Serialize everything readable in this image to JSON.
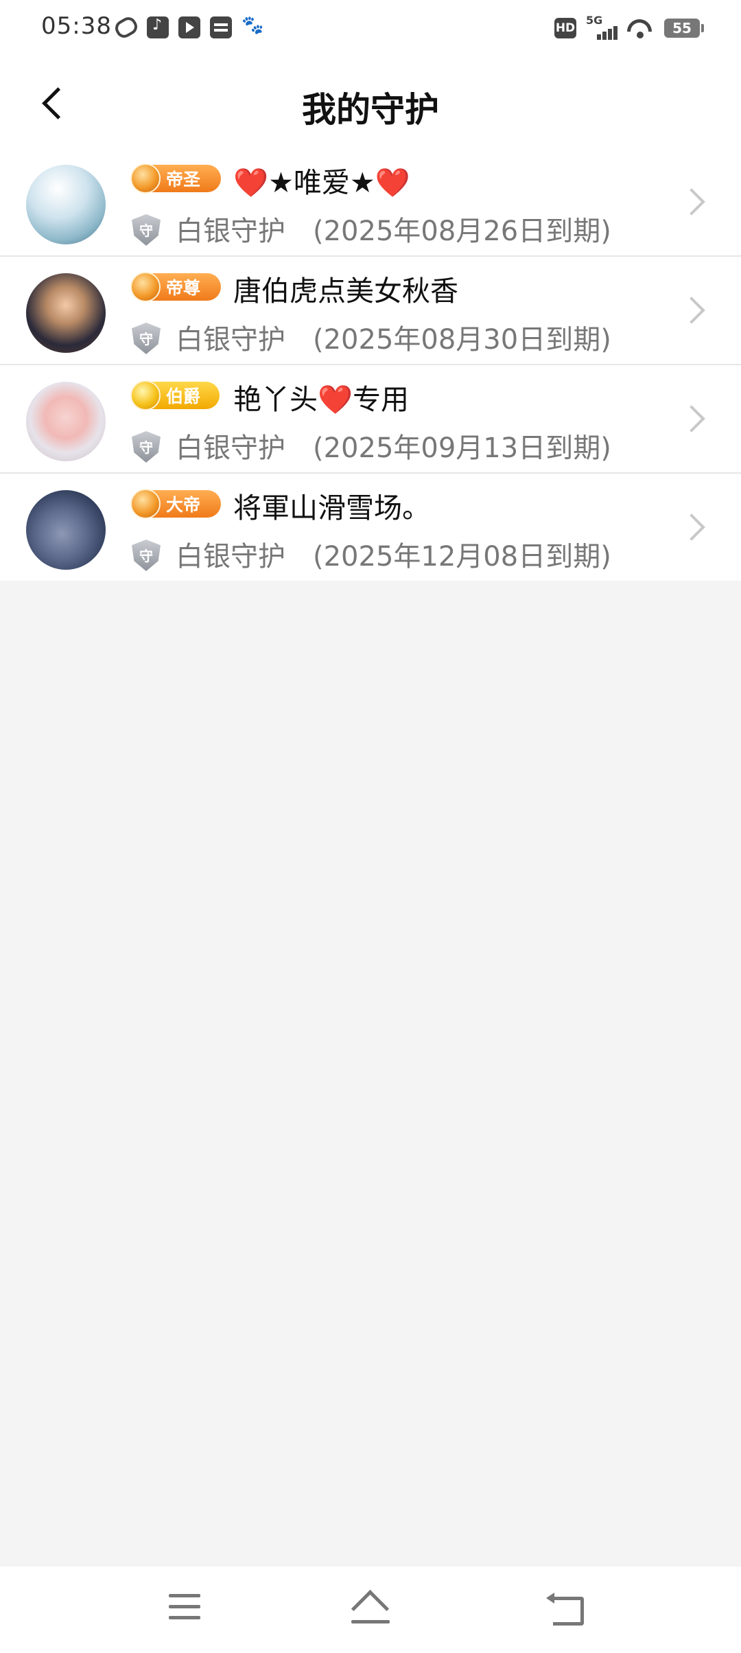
{
  "status_bar": {
    "time": "05:38",
    "notification_icons": [
      "loop-app-icon",
      "tiktok-icon",
      "video-player-icon",
      "wallet-icon",
      "baidu-paw-icon"
    ],
    "hd": "HD",
    "network": "5G",
    "battery": "55"
  },
  "header": {
    "title": "我的守护"
  },
  "guards": [
    {
      "badge": "帝圣",
      "badge_color": "#f07a1a",
      "nickname_parts": [
        "❤️",
        "★唯爱★",
        "❤️"
      ],
      "tier": "白银守护",
      "expiry": "(2025年08月26日到期)"
    },
    {
      "badge": "帝尊",
      "badge_color": "#f07a1a",
      "nickname": "唐伯虎点美女秋香",
      "tier": "白银守护",
      "expiry": "(2025年08月30日到期)"
    },
    {
      "badge": "伯爵",
      "badge_color": "#f2a900",
      "nickname_parts": [
        "艳丫头",
        "❤️",
        "专用"
      ],
      "tier": "白银守护",
      "expiry": "(2025年09月13日到期)"
    },
    {
      "badge": "大帝",
      "badge_color": "#f07a1a",
      "nickname": "将軍山滑雪场。",
      "tier": "白银守护",
      "expiry": "(2025年12月08日到期)"
    }
  ],
  "shield_glyph": "守",
  "colors": {
    "background": "#f4f4f4",
    "heart": "#e0232b",
    "secondary_text": "#777777"
  }
}
